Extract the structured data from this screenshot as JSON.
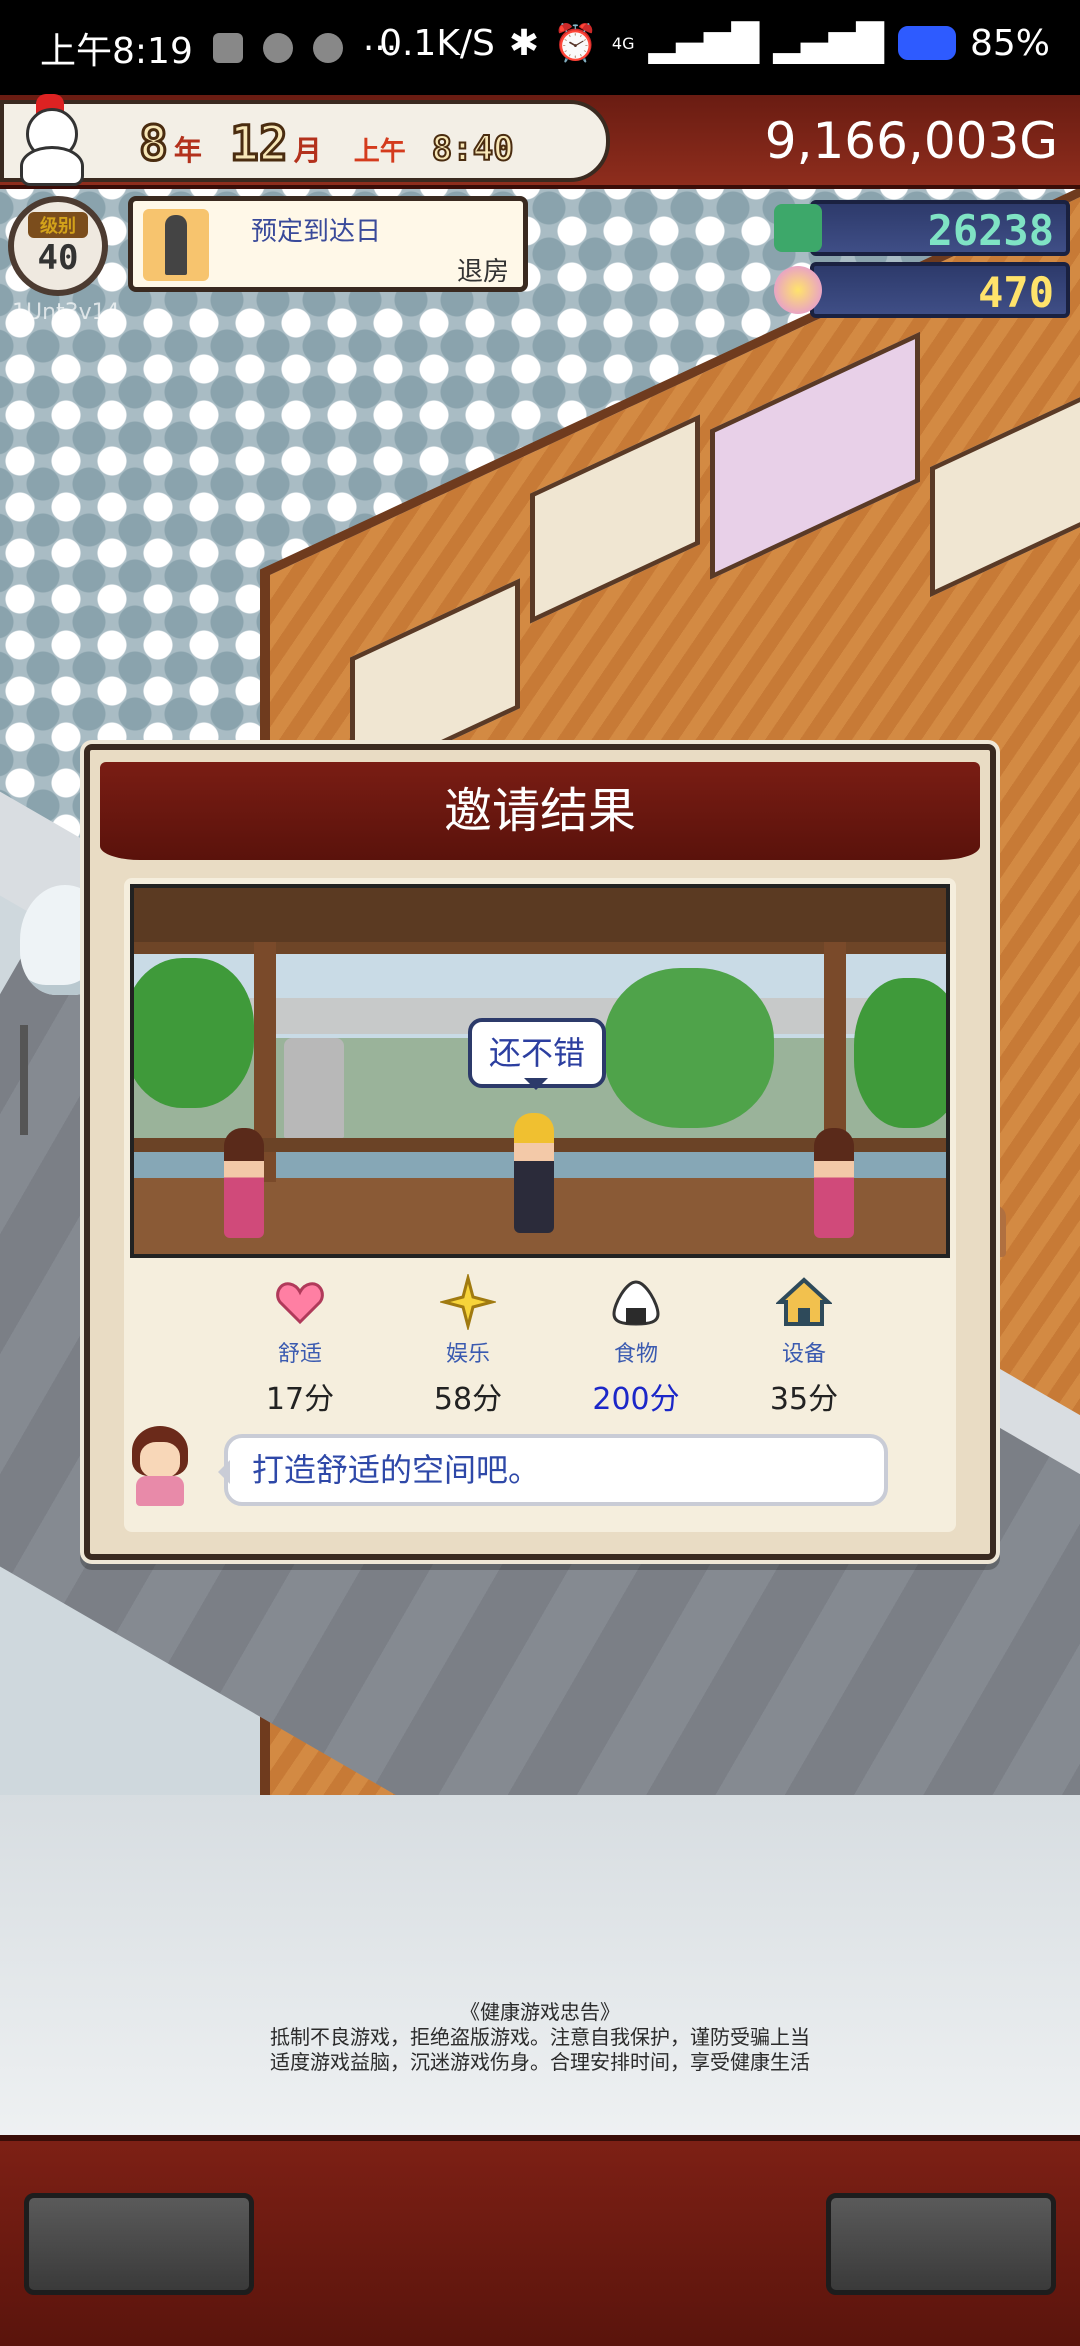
{
  "status_bar": {
    "time": "上午8:19",
    "more": "···",
    "network_speed": "0.1K/S",
    "signal_label": "4G",
    "battery": "85%"
  },
  "hud": {
    "year": "8",
    "year_unit": "年",
    "month": "12",
    "month_unit": "月",
    "ampm": "上午",
    "time": "8:40",
    "money": "9,166,003G",
    "level_label": "级别",
    "level": "40",
    "under_badge": "1Unt3v14",
    "reservation_title": "预定到达日",
    "reservation_status": "退房",
    "counter_1": "26238",
    "counter_2": "470"
  },
  "modal": {
    "title": "邀请结果",
    "bubble": "还不错",
    "stats": [
      {
        "name": "舒适",
        "score": "17分",
        "icon": "heart-icon"
      },
      {
        "name": "娱乐",
        "score": "58分",
        "icon": "star-icon"
      },
      {
        "name": "食物",
        "score": "200分",
        "icon": "onigiri-icon"
      },
      {
        "name": "设备",
        "score": "35分",
        "icon": "house-icon"
      }
    ],
    "advice": "打造舒适的空间吧。"
  },
  "notice": {
    "title": "《健康游戏忠告》",
    "line1": "抵制不良游戏，拒绝盗版游戏。注意自我保护，谨防受骗上当",
    "line2": "适度游戏益脑，沉迷游戏伤身。合理安排时间，享受健康生活"
  },
  "colors": {
    "hud_red": "#7a1d14",
    "modal_bg": "#e9dcc4",
    "score_highlight": "#1b27c8",
    "label_blue": "#3a5ab0"
  }
}
